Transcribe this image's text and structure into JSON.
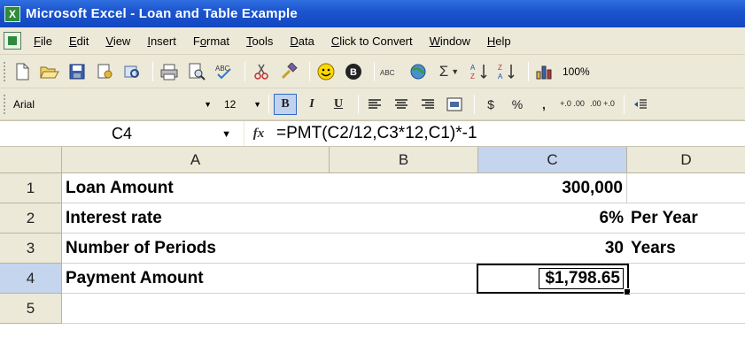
{
  "window": {
    "title": "Microsoft Excel - Loan and Table Example"
  },
  "menu": {
    "items": [
      {
        "acc": "F",
        "rest": "ile"
      },
      {
        "acc": "E",
        "rest": "dit"
      },
      {
        "acc": "V",
        "rest": "iew"
      },
      {
        "acc": "I",
        "rest": "nsert"
      },
      {
        "pre": "F",
        "acc": "o",
        "rest": "rmat"
      },
      {
        "acc": "T",
        "rest": "ools"
      },
      {
        "acc": "D",
        "rest": "ata"
      },
      {
        "acc": "C",
        "rest": "lick to Convert"
      },
      {
        "acc": "W",
        "rest": "indow"
      },
      {
        "acc": "H",
        "rest": "elp"
      }
    ]
  },
  "toolbar": {
    "icons": [
      "new-icon",
      "open-icon",
      "save-icon",
      "permission-icon",
      "research-icon",
      "print-icon",
      "print-preview-icon",
      "spelling-icon",
      "cut-icon",
      "format-painter-icon",
      "smiley-icon",
      "button-icon",
      "abc-icon",
      "globe-icon",
      "autosum-icon",
      "sort-ascending-icon",
      "sort-descending-icon",
      "chart-icon"
    ],
    "zoom": "100%"
  },
  "format": {
    "font": "Arial",
    "size": "12",
    "bold": "B",
    "italic": "I",
    "underline": "U",
    "currency": "$",
    "percent": "%",
    "comma": ",",
    "inc_decimal": "+.0 .00",
    "dec_decimal": ".00 +.0"
  },
  "formula_bar": {
    "name_box": "C4",
    "fx": "fx",
    "formula": "=PMT(C2/12,C3*12,C1)*-1"
  },
  "columns": [
    "A",
    "B",
    "C",
    "D"
  ],
  "selected_column": "C",
  "rows": [
    {
      "num": "1",
      "a": "Loan Amount",
      "c": "300,000",
      "d": ""
    },
    {
      "num": "2",
      "a": "Interest rate",
      "c": "6%",
      "d": "Per Year"
    },
    {
      "num": "3",
      "a": "Number of Periods",
      "c": "30",
      "d": "Years"
    },
    {
      "num": "4",
      "a": "Payment Amount",
      "c": "$1,798.65",
      "d": ""
    },
    {
      "num": "5",
      "a": "",
      "c": "",
      "d": ""
    }
  ],
  "selected_row": "4"
}
